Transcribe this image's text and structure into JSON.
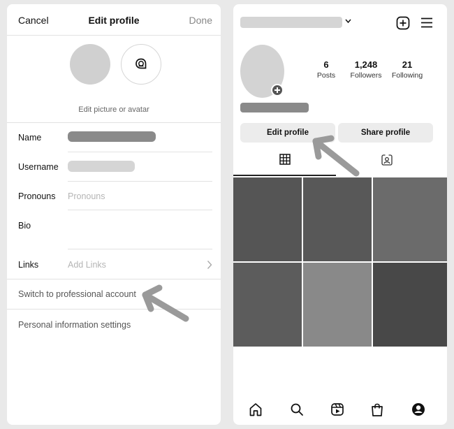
{
  "edit_profile": {
    "cancel_label": "Cancel",
    "title": "Edit profile",
    "done_label": "Done",
    "edit_picture_label": "Edit picture or avatar",
    "fields": {
      "name_label": "Name",
      "username_label": "Username",
      "pronouns_label": "Pronouns",
      "pronouns_placeholder": "Pronouns",
      "bio_label": "Bio",
      "links_label": "Links",
      "links_placeholder": "Add Links"
    },
    "switch_professional_label": "Switch to professional account",
    "personal_info_label": "Personal information settings"
  },
  "profile": {
    "stats": {
      "posts_count": "6",
      "posts_label": "Posts",
      "followers_count": "1,248",
      "followers_label": "Followers",
      "following_count": "21",
      "following_label": "Following"
    },
    "edit_profile_button": "Edit profile",
    "share_profile_button": "Share profile",
    "grid_colors": [
      "#555555",
      "#585858",
      "#6b6b6b",
      "#5c5c5c",
      "#898989",
      "#484848"
    ]
  },
  "colors": {
    "redaction_dark": "#8a8a8a",
    "redaction_light": "#d5d5d5",
    "annotation_arrow": "#9a9a9a"
  },
  "icons": [
    "chat-avatar-icon",
    "chevron-down-icon",
    "add-post-icon",
    "menu-icon",
    "grid-tab-icon",
    "tagged-tab-icon",
    "home-icon",
    "search-icon",
    "reels-icon",
    "shop-icon",
    "profile-icon",
    "chevron-right-icon",
    "plus-icon",
    "arrow-annotation"
  ]
}
